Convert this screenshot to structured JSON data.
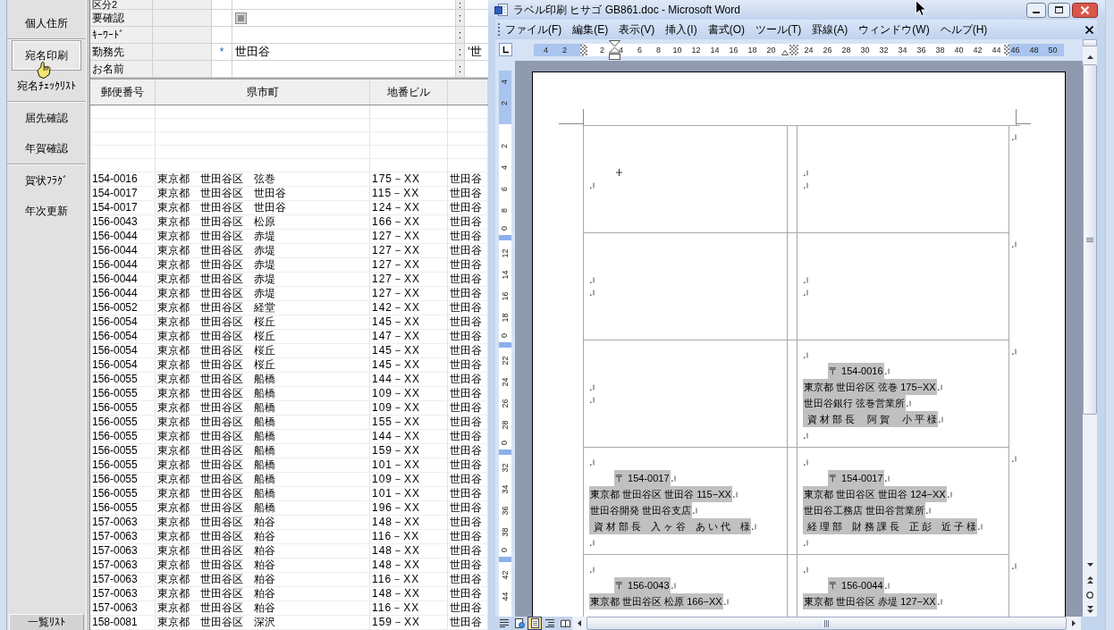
{
  "sidebar": {
    "groups": [
      {
        "items": [
          {
            "label": "個人住所",
            "selected": false
          }
        ]
      },
      {
        "items": [
          {
            "label": "宛名印刷",
            "selected": true
          },
          {
            "label": "宛名ﾁｪｯｸﾘｽﾄ",
            "selected": false
          }
        ]
      },
      {
        "items": [
          {
            "label": "届先確認",
            "selected": false
          },
          {
            "label": "年賀確認",
            "selected": false
          }
        ]
      },
      {
        "items": [
          {
            "label": "賀状ﾌﾗｸﾞ",
            "selected": false
          },
          {
            "label": "年次更新",
            "selected": false
          }
        ]
      }
    ],
    "footer_button": "一覧ﾘｽﾄ"
  },
  "form": {
    "rows": [
      {
        "label": "区分2",
        "kind": "text",
        "separator": ":"
      },
      {
        "label": "要確認",
        "kind": "checkbox",
        "indeterminate": true,
        "separator": ":"
      },
      {
        "label": "ｷｰﾜｰﾄﾞ",
        "kind": "text",
        "separator": ":"
      },
      {
        "label": "勤務先",
        "kind": "text",
        "marker": "*",
        "value": "世田谷",
        "separator": ":",
        "extra": "’世"
      },
      {
        "label": "お名前",
        "kind": "text",
        "separator": ":"
      }
    ]
  },
  "table": {
    "columns": [
      "郵便番号",
      "県市町",
      "地番ビル"
    ],
    "rows": [
      [
        "154-0016",
        "東京都　世田谷区　弦巻",
        "175－XX",
        "世田谷"
      ],
      [
        "154-0017",
        "東京都　世田谷区　世田谷",
        "115－XX",
        "世田谷"
      ],
      [
        "154-0017",
        "東京都　世田谷区　世田谷",
        "124－XX",
        "世田谷"
      ],
      [
        "156-0043",
        "東京都　世田谷区　松原",
        "166－XX",
        "世田谷"
      ],
      [
        "156-0044",
        "東京都　世田谷区　赤堤",
        "127－XX",
        "世田谷"
      ],
      [
        "156-0044",
        "東京都　世田谷区　赤堤",
        "127－XX",
        "世田谷"
      ],
      [
        "156-0044",
        "東京都　世田谷区　赤堤",
        "127－XX",
        "世田谷"
      ],
      [
        "156-0044",
        "東京都　世田谷区　赤堤",
        "127－XX",
        "世田谷"
      ],
      [
        "156-0044",
        "東京都　世田谷区　赤堤",
        "127－XX",
        "世田谷"
      ],
      [
        "156-0052",
        "東京都　世田谷区　経堂",
        "142－XX",
        "世田谷"
      ],
      [
        "156-0054",
        "東京都　世田谷区　桜丘",
        "145－XX",
        "世田谷"
      ],
      [
        "156-0054",
        "東京都　世田谷区　桜丘",
        "147－XX",
        "世田谷"
      ],
      [
        "156-0054",
        "東京都　世田谷区　桜丘",
        "145－XX",
        "世田谷"
      ],
      [
        "156-0054",
        "東京都　世田谷区　桜丘",
        "145－XX",
        "世田谷"
      ],
      [
        "156-0055",
        "東京都　世田谷区　船橋",
        "144－XX",
        "世田谷"
      ],
      [
        "156-0055",
        "東京都　世田谷区　船橋",
        "109－XX",
        "世田谷"
      ],
      [
        "156-0055",
        "東京都　世田谷区　船橋",
        "109－XX",
        "世田谷"
      ],
      [
        "156-0055",
        "東京都　世田谷区　船橋",
        "155－XX",
        "世田谷"
      ],
      [
        "156-0055",
        "東京都　世田谷区　船橋",
        "144－XX",
        "世田谷"
      ],
      [
        "156-0055",
        "東京都　世田谷区　船橋",
        "159－XX",
        "世田谷"
      ],
      [
        "156-0055",
        "東京都　世田谷区　船橋",
        "101－XX",
        "世田谷"
      ],
      [
        "156-0055",
        "東京都　世田谷区　船橋",
        "109－XX",
        "世田谷"
      ],
      [
        "156-0055",
        "東京都　世田谷区　船橋",
        "101－XX",
        "世田谷"
      ],
      [
        "156-0055",
        "東京都　世田谷区　船橋",
        "196－XX",
        "世田谷"
      ],
      [
        "157-0063",
        "東京都　世田谷区　粕谷",
        "148－XX",
        "世田谷"
      ],
      [
        "157-0063",
        "東京都　世田谷区　粕谷",
        "116－XX",
        "世田谷"
      ],
      [
        "157-0063",
        "東京都　世田谷区　粕谷",
        "148－XX",
        "世田谷"
      ],
      [
        "157-0063",
        "東京都　世田谷区　粕谷",
        "148－XX",
        "世田谷"
      ],
      [
        "157-0063",
        "東京都　世田谷区　粕谷",
        "116－XX",
        "世田谷"
      ],
      [
        "157-0063",
        "東京都　世田谷区　粕谷",
        "148－XX",
        "世田谷"
      ],
      [
        "157-0063",
        "東京都　世田谷区　粕谷",
        "116－XX",
        "世田谷"
      ],
      [
        "158-0081",
        "東京都　世田谷区　深沢",
        "159－XX",
        "世田谷"
      ]
    ]
  },
  "word": {
    "title": "ラベル印刷 ヒサゴ GB861.doc - Microsoft Word",
    "menu": [
      "ファイル(F)",
      "編集(E)",
      "表示(V)",
      "挿入(I)",
      "書式(O)",
      "ツール(T)",
      "罫線(A)",
      "ウィンドウ(W)",
      "ヘルプ(H)"
    ],
    "h_ruler": [
      {
        "kind": "number",
        "text": "4"
      },
      {
        "kind": "number",
        "text": "2"
      },
      {
        "kind": "margin"
      },
      {
        "kind": "number",
        "text": "2"
      },
      {
        "kind": "number",
        "text": "4"
      },
      {
        "kind": "number",
        "text": "6"
      },
      {
        "kind": "number",
        "text": "8"
      },
      {
        "kind": "number",
        "text": "10"
      },
      {
        "kind": "number",
        "text": "12"
      },
      {
        "kind": "number",
        "text": "14"
      },
      {
        "kind": "number",
        "text": "16"
      },
      {
        "kind": "number",
        "text": "18"
      },
      {
        "kind": "number",
        "text": "20"
      },
      {
        "kind": "columns"
      },
      {
        "kind": "number",
        "text": "24"
      },
      {
        "kind": "number",
        "text": "26"
      },
      {
        "kind": "number",
        "text": "28"
      },
      {
        "kind": "number",
        "text": "30"
      },
      {
        "kind": "number",
        "text": "32"
      },
      {
        "kind": "number",
        "text": "34"
      },
      {
        "kind": "number",
        "text": "36"
      },
      {
        "kind": "number",
        "text": "38"
      },
      {
        "kind": "number",
        "text": "40"
      },
      {
        "kind": "number",
        "text": "42"
      },
      {
        "kind": "number",
        "text": "44"
      },
      {
        "kind": "number",
        "text": "46"
      },
      {
        "kind": "number",
        "text": "48"
      },
      {
        "kind": "number",
        "text": "50"
      }
    ],
    "v_ruler": [
      {
        "kind": "number",
        "text": "4"
      },
      {
        "kind": "number",
        "text": "2"
      },
      {
        "kind": "gap"
      },
      {
        "kind": "number",
        "text": "2"
      },
      {
        "kind": "number",
        "text": "4"
      },
      {
        "kind": "number",
        "text": "6"
      },
      {
        "kind": "number",
        "text": "8"
      },
      {
        "kind": "row",
        "text": "0"
      },
      {
        "kind": "number",
        "text": "12"
      },
      {
        "kind": "number",
        "text": "14"
      },
      {
        "kind": "number",
        "text": "16"
      },
      {
        "kind": "number",
        "text": "18"
      },
      {
        "kind": "row",
        "text": "0"
      },
      {
        "kind": "number",
        "text": "22"
      },
      {
        "kind": "number",
        "text": "24"
      },
      {
        "kind": "number",
        "text": "26"
      },
      {
        "kind": "number",
        "text": "28"
      },
      {
        "kind": "row",
        "text": "0"
      },
      {
        "kind": "number",
        "text": "32"
      },
      {
        "kind": "number",
        "text": "34"
      },
      {
        "kind": "number",
        "text": "36"
      },
      {
        "kind": "number",
        "text": "38"
      },
      {
        "kind": "row",
        "text": "0"
      },
      {
        "kind": "number",
        "text": "42"
      },
      {
        "kind": "number",
        "text": "44"
      }
    ],
    "label_rows": [
      {
        "cells": [
          {
            "kind": "blank",
            "lines": [
              {
                "kind": "cursor"
              },
              {
                "kind": "blank"
              }
            ]
          },
          {
            "kind": "blank",
            "lines": [
              {
                "kind": "blank"
              },
              {
                "kind": "blank"
              }
            ]
          }
        ]
      },
      {
        "cells": [
          {
            "kind": "blank",
            "lines": [
              {
                "kind": "blank"
              },
              {
                "kind": "blank"
              }
            ]
          },
          {
            "kind": "blank",
            "lines": [
              {
                "kind": "blank"
              },
              {
                "kind": "blank"
              }
            ]
          }
        ]
      },
      {
        "cells": [
          {
            "kind": "blank",
            "lines": [
              {
                "kind": "blank"
              },
              {
                "kind": "blank"
              }
            ]
          },
          {
            "kind": "address",
            "lines": [
              {
                "kind": "blank"
              },
              {
                "kind": "postal",
                "text": "〒 154-0016"
              },
              {
                "kind": "text",
                "text": "東京都 世田谷区 弦巻 175−XX"
              },
              {
                "kind": "text",
                "text": "世田谷銀行 弦巻営業所"
              },
              {
                "kind": "name",
                "text": "資 材 部 長　 阿 賀　 小 平 様"
              },
              {
                "kind": "blank"
              }
            ]
          }
        ]
      },
      {
        "cells": [
          {
            "kind": "address",
            "lines": [
              {
                "kind": "blank"
              },
              {
                "kind": "postal",
                "text": "〒 154-0017"
              },
              {
                "kind": "text",
                "text": "東京都 世田谷区 世田谷 115−XX"
              },
              {
                "kind": "text",
                "text": "世田谷開発 世田谷支店"
              },
              {
                "kind": "name",
                "text": "資 材 部 長　入 ヶ 谷　あ い 代　様"
              },
              {
                "kind": "blank"
              }
            ]
          },
          {
            "kind": "address",
            "lines": [
              {
                "kind": "blank"
              },
              {
                "kind": "postal",
                "text": "〒 154-0017"
              },
              {
                "kind": "text",
                "text": "東京都 世田谷区 世田谷 124−XX"
              },
              {
                "kind": "text",
                "text": "世田谷工務店 世田谷営業所"
              },
              {
                "kind": "name",
                "text": "経 理 部　財 務 課 長　正 彭　近 子 様"
              },
              {
                "kind": "blank"
              }
            ]
          }
        ]
      },
      {
        "cells": [
          {
            "kind": "address",
            "lines": [
              {
                "kind": "blank"
              },
              {
                "kind": "postal",
                "text": "〒 156-0043"
              },
              {
                "kind": "text",
                "text": "東京都 世田谷区 松原 166−XX"
              }
            ]
          },
          {
            "kind": "address",
            "lines": [
              {
                "kind": "blank"
              },
              {
                "kind": "postal",
                "text": "〒 156-0044"
              },
              {
                "kind": "text",
                "text": "東京都 世田谷区 赤堤 127−XX"
              }
            ]
          }
        ]
      }
    ],
    "views": [
      {
        "kind": "normal",
        "selected": false
      },
      {
        "kind": "web",
        "selected": false
      },
      {
        "kind": "print",
        "selected": true
      },
      {
        "kind": "outline",
        "selected": false
      },
      {
        "kind": "reading",
        "selected": false
      }
    ]
  }
}
